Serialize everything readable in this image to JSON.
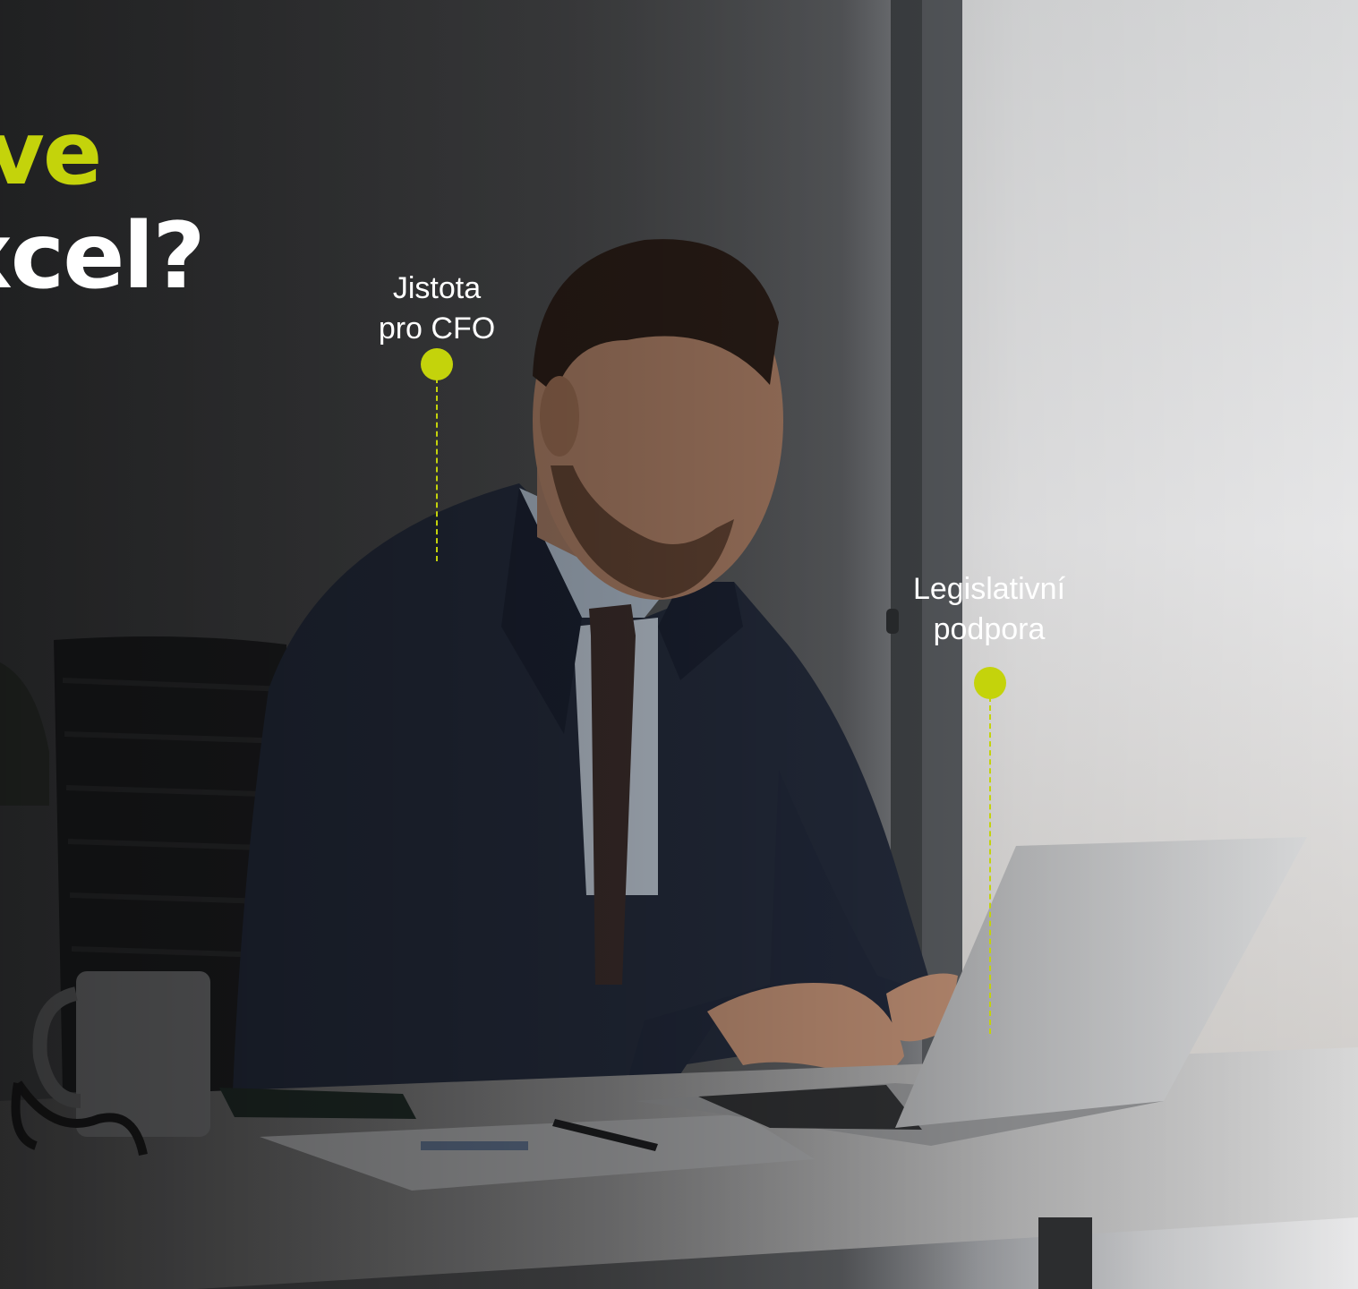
{
  "headline": {
    "line1": "ve",
    "line2": "xcel?"
  },
  "markers": [
    {
      "lines": [
        "Jistota",
        "pro CFO"
      ]
    },
    {
      "lines": [
        "Legislativní",
        "podpora"
      ]
    }
  ],
  "colors": {
    "accent": "#c4d30b",
    "text": "#ffffff"
  }
}
